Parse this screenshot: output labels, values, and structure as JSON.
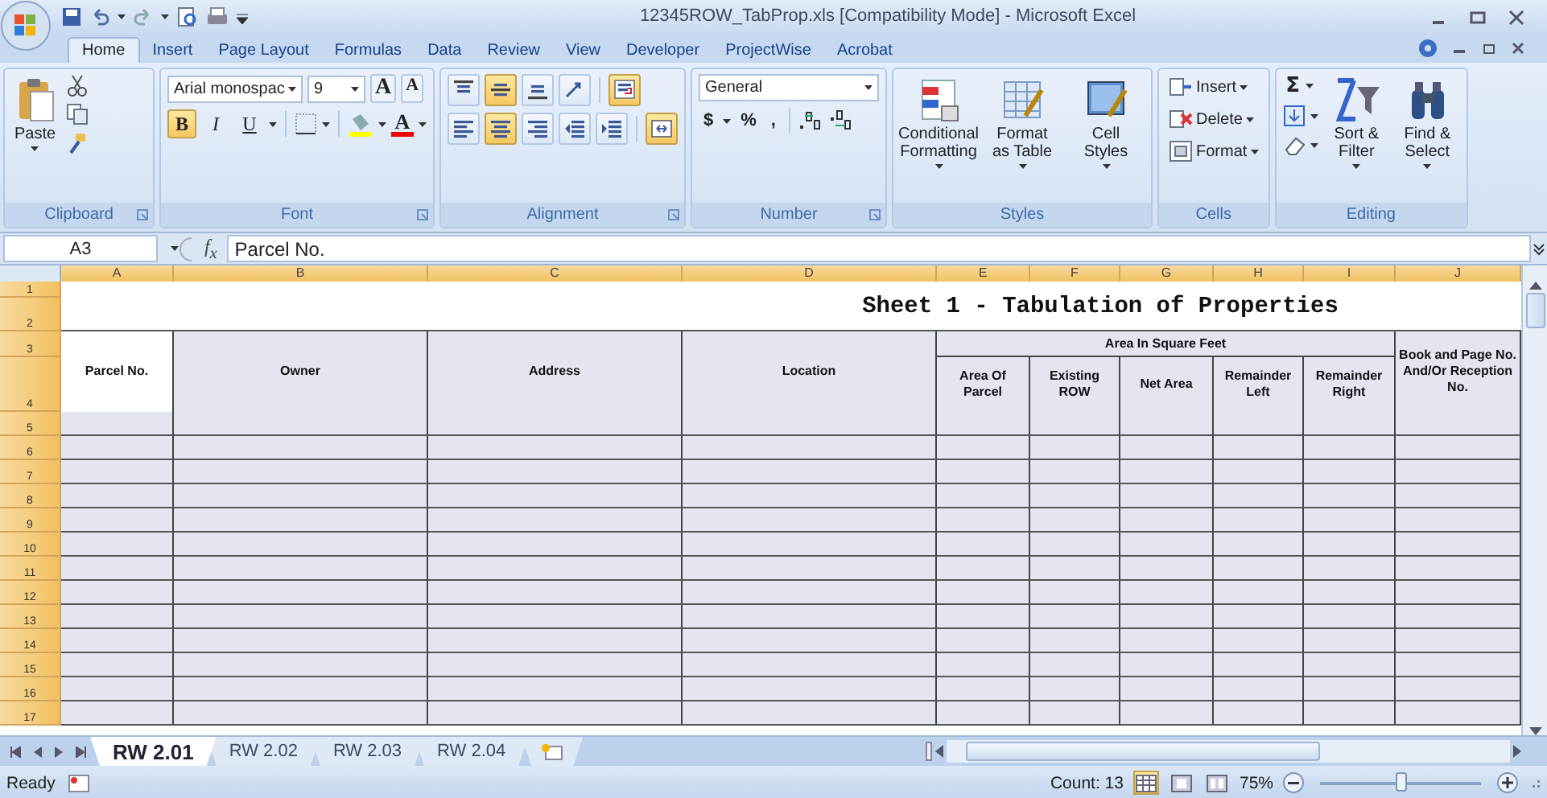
{
  "window": {
    "title": "12345ROW_TabProp.xls  [Compatibility Mode] - Microsoft Excel"
  },
  "ribbon": {
    "tabs": [
      {
        "label": "Home",
        "selected": true
      },
      {
        "label": "Insert",
        "selected": false
      },
      {
        "label": "Page Layout",
        "selected": false
      },
      {
        "label": "Formulas",
        "selected": false
      },
      {
        "label": "Data",
        "selected": false
      },
      {
        "label": "Review",
        "selected": false
      },
      {
        "label": "View",
        "selected": false
      },
      {
        "label": "Developer",
        "selected": false
      },
      {
        "label": "ProjectWise",
        "selected": false
      },
      {
        "label": "Acrobat",
        "selected": false
      }
    ],
    "groups": [
      {
        "name": "Clipboard",
        "kind": "clipboard",
        "paste_label": "Paste"
      },
      {
        "name": "Font",
        "kind": "font",
        "font_name": "Arial monospac",
        "font_size": "9",
        "grow_label": "A",
        "shrink_label": "A",
        "toggles": [
          {
            "label": "B",
            "on": true
          },
          {
            "label": "I",
            "on": false
          },
          {
            "label": "U",
            "on": false
          }
        ],
        "color_label": "A"
      },
      {
        "name": "Alignment",
        "kind": "alignment",
        "buttons": [
          {
            "kind": "top",
            "on": false
          },
          {
            "kind": "middle",
            "on": true
          },
          {
            "kind": "bottom",
            "on": false
          },
          {
            "kind": "orientation",
            "on": false
          },
          {
            "kind": "wrap",
            "on": true
          },
          {
            "kind": "left",
            "on": false
          },
          {
            "kind": "center",
            "on": true
          },
          {
            "kind": "right",
            "on": false
          },
          {
            "kind": "outdent",
            "on": false
          },
          {
            "kind": "indent",
            "on": false
          },
          {
            "kind": "merge",
            "on": true
          }
        ]
      },
      {
        "name": "Number",
        "kind": "number",
        "format": "General",
        "symbols": [
          "$",
          "%",
          ","
        ]
      },
      {
        "name": "Styles",
        "kind": "styles",
        "buttons": [
          {
            "kind": "conditional",
            "label": "Conditional Formatting"
          },
          {
            "kind": "table",
            "label": "Format as Table"
          },
          {
            "kind": "cell",
            "label": "Cell Styles"
          }
        ]
      },
      {
        "name": "Cells",
        "kind": "cells",
        "buttons": [
          {
            "kind": "insert",
            "label": "Insert"
          },
          {
            "kind": "delete",
            "label": "Delete"
          },
          {
            "kind": "format",
            "label": "Format"
          }
        ]
      },
      {
        "name": "Editing",
        "kind": "editing",
        "sum_label": "Σ",
        "buttons": [
          {
            "kind": "sort",
            "label": "Sort & Filter"
          },
          {
            "kind": "find",
            "label": "Find & Select"
          }
        ]
      }
    ]
  },
  "formula_bar": {
    "name_box": "A3",
    "function_label": "f$_{x}$",
    "formula": "Parcel No."
  },
  "table": {
    "columns": [
      "A",
      "B",
      "C",
      "D",
      "E",
      "F",
      "G",
      "H",
      "I",
      "J"
    ],
    "rows": [
      "1",
      "2",
      "3",
      "4",
      "5",
      "6",
      "7",
      "8",
      "9",
      "10",
      "11",
      "12",
      "13",
      "14",
      "15",
      "16",
      "17"
    ],
    "title": "Sheet 1 - Tabulation of Properties",
    "headers": [
      {
        "label": "Parcel No.",
        "active": true
      },
      {
        "label": "Owner",
        "active": false
      },
      {
        "label": "Address",
        "active": false
      },
      {
        "label": "Location",
        "active": false
      }
    ],
    "area_group": {
      "label": "Area In Square Feet",
      "subheaders": [
        "Area Of Parcel",
        "Existing ROW",
        "Net Area",
        "Remainder Left",
        "Remainder Right"
      ]
    },
    "reception_header": "Book and Page No. And/Or Reception No."
  },
  "sheet_tabs": [
    {
      "label": "RW 2.01",
      "selected": true
    },
    {
      "label": "RW 2.02",
      "selected": false
    },
    {
      "label": "RW 2.03",
      "selected": false
    },
    {
      "label": "RW 2.04",
      "selected": false
    }
  ],
  "status_bar": {
    "mode": "Ready",
    "count": "Count: 13",
    "views": [
      {
        "kind": "normal",
        "selected": true
      },
      {
        "kind": "layout",
        "selected": false
      },
      {
        "kind": "pagebreak",
        "selected": false
      }
    ],
    "zoom": "75%",
    "zoom_slider": {
      "level": 0.5
    }
  }
}
